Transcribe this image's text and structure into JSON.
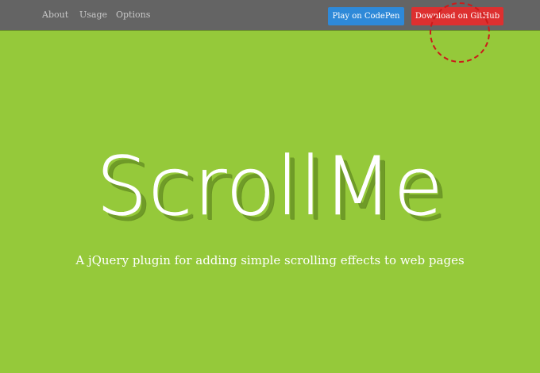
{
  "nav": {
    "items": [
      {
        "label": "About"
      },
      {
        "label": "Usage"
      },
      {
        "label": "Options"
      }
    ]
  },
  "actions": {
    "codepen_label": "Play on CodePen",
    "github_label": "Download on GitHub"
  },
  "hero": {
    "title": "ScrollMe",
    "subtitle": "A jQuery plugin for adding simple scrolling effects to web pages"
  },
  "colors": {
    "background": "#95c93a",
    "topbar": "#646464",
    "codepen_button": "#2e89d8",
    "github_button": "#dd3030",
    "highlight_circle": "#cc1a1a"
  }
}
